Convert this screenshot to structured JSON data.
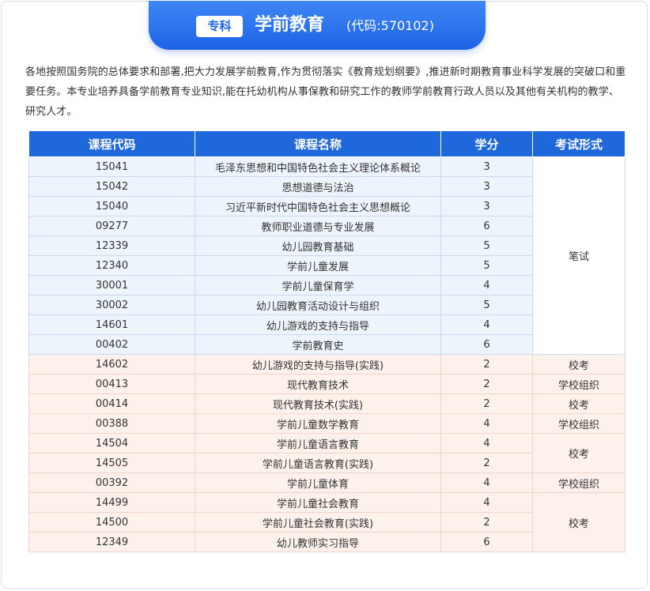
{
  "header": {
    "badge": "专科",
    "major_name": "学前教育",
    "major_code": "(代码:570102)"
  },
  "intro": "各地按照国务院的总体要求和部署,把大力发展学前教育,作为贯彻落实《教育规划纲要》,推进新时期教育事业科学发展的突破口和重要任务。本专业培养具备学前教育专业知识,能在托幼机构从事保教和研究工作的教师学前教育行政人员以及其他有关机构的教学、研究人才。",
  "table": {
    "columns": [
      "课程代码",
      "课程名称",
      "学分",
      "考试形式"
    ],
    "rows": [
      {
        "code": "15041",
        "name": "毛泽东思想和中国特色社会主义理论体系概论",
        "credit": "3"
      },
      {
        "code": "15042",
        "name": "思想道德与法治",
        "credit": "3"
      },
      {
        "code": "15040",
        "name": "习近平新时代中国特色社会主义思想概论",
        "credit": "3"
      },
      {
        "code": "09277",
        "name": "教师职业道德与专业发展",
        "credit": "6"
      },
      {
        "code": "12339",
        "name": "幼儿园教育基础",
        "credit": "5"
      },
      {
        "code": "12340",
        "name": "学前儿童发展",
        "credit": "5"
      },
      {
        "code": "30001",
        "name": "学前儿童保育学",
        "credit": "4"
      },
      {
        "code": "30002",
        "name": "幼儿园教育活动设计与组织",
        "credit": "5"
      },
      {
        "code": "14601",
        "name": "幼儿游戏的支持与指导",
        "credit": "4"
      },
      {
        "code": "00402",
        "name": "学前教育史",
        "credit": "6"
      },
      {
        "code": "14602",
        "name": "幼儿游戏的支持与指导(实践)",
        "credit": "2"
      },
      {
        "code": "00413",
        "name": "现代教育技术",
        "credit": "2"
      },
      {
        "code": "00414",
        "name": "现代教育技术(实践)",
        "credit": "2"
      },
      {
        "code": "00388",
        "name": "学前儿童数学教育",
        "credit": "4"
      },
      {
        "code": "14504",
        "name": "学前儿童语言教育",
        "credit": "4"
      },
      {
        "code": "14505",
        "name": "学前儿童语言教育(实践)",
        "credit": "2"
      },
      {
        "code": "00392",
        "name": "学前儿童体育",
        "credit": "4"
      },
      {
        "code": "14499",
        "name": "学前儿童社会教育",
        "credit": "4"
      },
      {
        "code": "14500",
        "name": "学前儿童社会教育(实践)",
        "credit": "2"
      },
      {
        "code": "12349",
        "name": "幼儿教师实习指导",
        "credit": "6"
      }
    ],
    "exam_groups": [
      {
        "label": "笔试",
        "span": 10
      },
      {
        "label": "校考",
        "span": 1
      },
      {
        "label": "学校组织",
        "span": 1
      },
      {
        "label": "校考",
        "span": 1
      },
      {
        "label": "学校组织",
        "span": 1
      },
      {
        "label": "校考",
        "span": 2
      },
      {
        "label": "学校组织",
        "span": 1
      },
      {
        "label": "校考",
        "span": 3
      }
    ]
  }
}
